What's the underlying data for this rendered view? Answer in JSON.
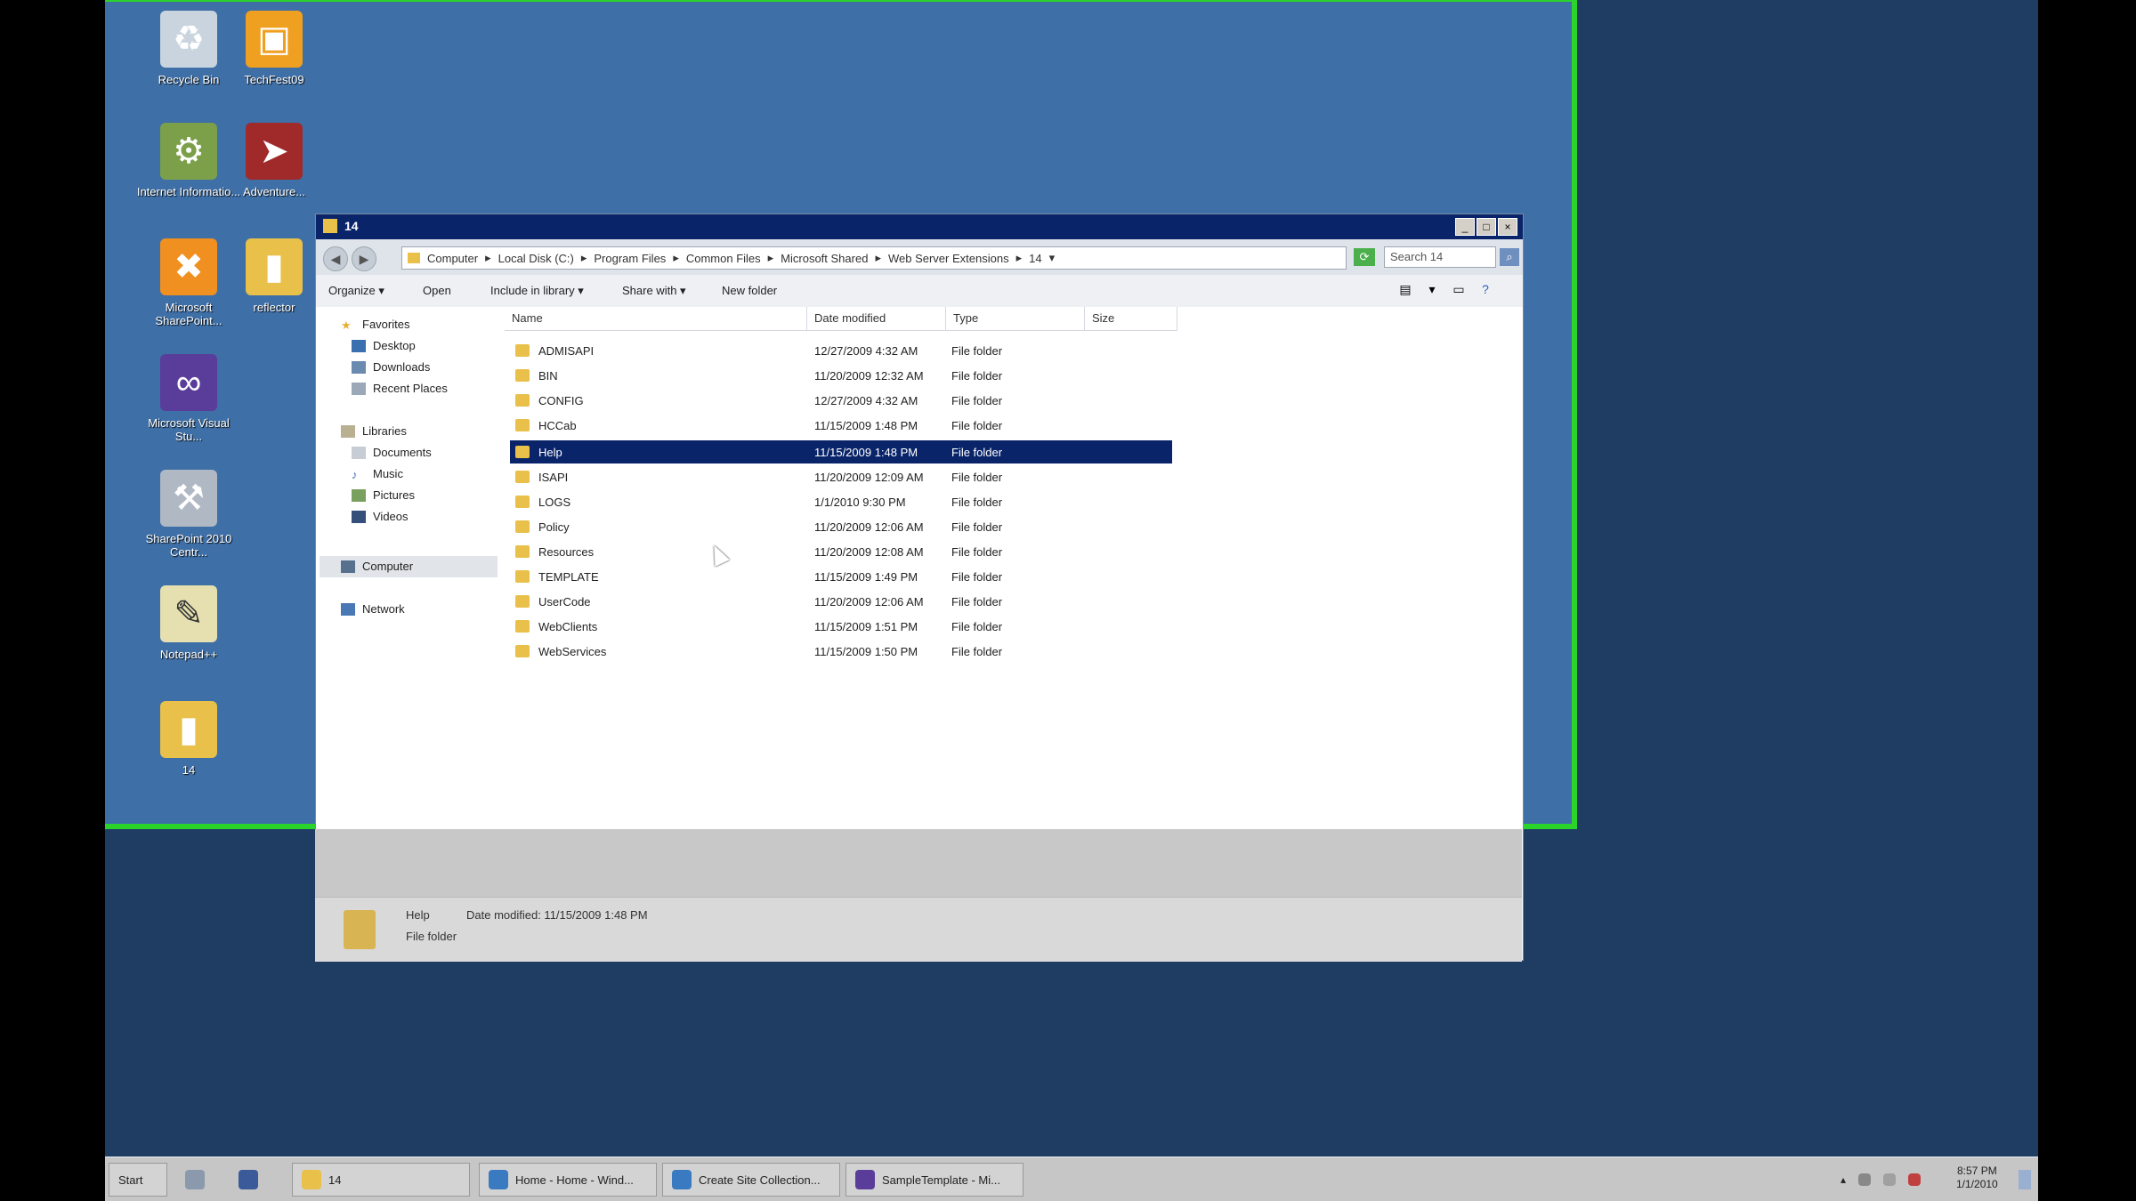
{
  "desktop": {
    "icons": [
      {
        "label": "Recycle Bin",
        "icon": "recycle-bin-icon",
        "color": "#c9d4de"
      },
      {
        "label": "TechFest09",
        "icon": "techfest-icon",
        "color": "#f0a020"
      },
      {
        "label": "Internet Informatio...",
        "icon": "iis-icon",
        "color": "#7ca04a"
      },
      {
        "label": "Adventure...",
        "icon": "adventure-icon",
        "color": "#a02a2a"
      },
      {
        "label": "Microsoft SharePoint...",
        "icon": "sharepoint-icon",
        "color": "#f09020"
      },
      {
        "label": "reflector",
        "icon": "folder-icon",
        "color": "#e8c04a"
      },
      {
        "label": "Microsoft Visual Stu...",
        "icon": "visual-studio-icon",
        "color": "#5a3c9a"
      },
      {
        "label": "SharePoint 2010 Centr...",
        "icon": "tools-icon",
        "color": "#b0b8c4"
      },
      {
        "label": "Notepad++",
        "icon": "notepad-icon",
        "color": "#e6e0b0"
      },
      {
        "label": "14",
        "icon": "folder-icon",
        "color": "#e8c04a"
      }
    ]
  },
  "window": {
    "title": "14",
    "controls": {
      "minimize": "_",
      "maximize": "□",
      "close": "×"
    },
    "address": {
      "crumbs": [
        "Computer",
        "Local Disk (C:)",
        "Program Files",
        "Common Files",
        "Microsoft Shared",
        "Web Server Extensions",
        "14"
      ],
      "search_placeholder": "Search 14"
    },
    "toolbar": {
      "organize": "Organize ▾",
      "open": "Open",
      "include": "Include in library ▾",
      "share": "Share with ▾",
      "new_folder": "New folder"
    },
    "nav": {
      "favorites": "Favorites",
      "desktop": "Desktop",
      "downloads": "Downloads",
      "recent": "Recent Places",
      "libraries": "Libraries",
      "documents": "Documents",
      "music": "Music",
      "pictures": "Pictures",
      "videos": "Videos",
      "computer": "Computer",
      "network": "Network"
    },
    "columns": {
      "name": "Name",
      "date": "Date modified",
      "type": "Type",
      "size": "Size"
    },
    "files": [
      {
        "name": "ADMISAPI",
        "date": "12/27/2009 4:32 AM",
        "type": "File folder"
      },
      {
        "name": "BIN",
        "date": "11/20/2009 12:32 AM",
        "type": "File folder"
      },
      {
        "name": "CONFIG",
        "date": "12/27/2009 4:32 AM",
        "type": "File folder"
      },
      {
        "name": "HCCab",
        "date": "11/15/2009 1:48 PM",
        "type": "File folder"
      },
      {
        "name": "Help",
        "date": "11/15/2009 1:48 PM",
        "type": "File folder"
      },
      {
        "name": "ISAPI",
        "date": "11/20/2009 12:09 AM",
        "type": "File folder"
      },
      {
        "name": "LOGS",
        "date": "1/1/2010 9:30 PM",
        "type": "File folder"
      },
      {
        "name": "Policy",
        "date": "11/20/2009 12:06 AM",
        "type": "File folder"
      },
      {
        "name": "Resources",
        "date": "11/20/2009 12:08 AM",
        "type": "File folder"
      },
      {
        "name": "TEMPLATE",
        "date": "11/15/2009 1:49 PM",
        "type": "File folder"
      },
      {
        "name": "UserCode",
        "date": "11/20/2009 12:06 AM",
        "type": "File folder"
      },
      {
        "name": "WebClients",
        "date": "11/15/2009 1:51 PM",
        "type": "File folder"
      },
      {
        "name": "WebServices",
        "date": "11/15/2009 1:50 PM",
        "type": "File folder"
      }
    ],
    "selected_index": 4,
    "details": {
      "name": "Help",
      "date_label": "Date modified: 11/15/2009 1:48 PM",
      "type": "File folder"
    }
  },
  "taskbar": {
    "start": "Start",
    "items": [
      {
        "label": "14",
        "icon": "folder-icon"
      },
      {
        "label": "Home - Home - Wind...",
        "icon": "ie-icon"
      },
      {
        "label": "Create Site Collection...",
        "icon": "ie-icon"
      },
      {
        "label": "SampleTemplate - Mi...",
        "icon": "visual-studio-icon"
      }
    ],
    "time": "8:57 PM",
    "date": "1/1/2010"
  },
  "colors": {
    "desktop": "#3e6fa6",
    "outer": "#1f3d63",
    "highlight_border": "#2bd42b",
    "titlebar": "#0a246a",
    "selection": "#0a246a"
  }
}
